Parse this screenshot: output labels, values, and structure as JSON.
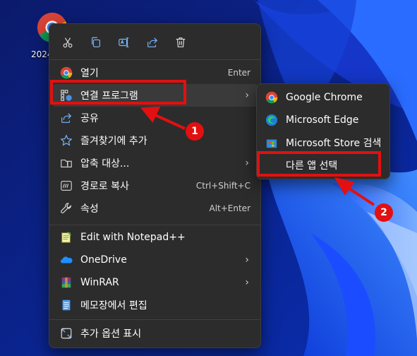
{
  "desktop": {
    "icon_label": "2024"
  },
  "quick_actions": [
    {
      "name": "cut-icon"
    },
    {
      "name": "copy-icon"
    },
    {
      "name": "rename-icon"
    },
    {
      "name": "share-icon"
    },
    {
      "name": "delete-icon"
    }
  ],
  "menu": {
    "open": {
      "label": "열기",
      "shortcut": "Enter"
    },
    "open_with": {
      "label": "연결 프로그램"
    },
    "share": {
      "label": "공유"
    },
    "add_favorites": {
      "label": "즐겨찾기에 추가"
    },
    "compress": {
      "label": "압축 대상..."
    },
    "copy_path": {
      "label": "경로로 복사",
      "shortcut": "Ctrl+Shift+C"
    },
    "properties": {
      "label": "속성",
      "shortcut": "Alt+Enter"
    },
    "notepadpp": {
      "label": "Edit with Notepad++"
    },
    "onedrive": {
      "label": "OneDrive"
    },
    "winrar": {
      "label": "WinRAR"
    },
    "notepad": {
      "label": "메모장에서 편집"
    },
    "more_options": {
      "label": "추가 옵션 표시"
    }
  },
  "submenu": {
    "chrome": {
      "label": "Google Chrome"
    },
    "edge": {
      "label": "Microsoft Edge"
    },
    "store": {
      "label": "Microsoft Store 검색"
    },
    "choose_app": {
      "label": "다른 앱 선택"
    }
  },
  "annotations": {
    "badge1": "1",
    "badge2": "2"
  },
  "colors": {
    "menu_bg": "#2c2c2c",
    "highlight": "#e21010",
    "wallpaper": "#0a1f8c"
  }
}
